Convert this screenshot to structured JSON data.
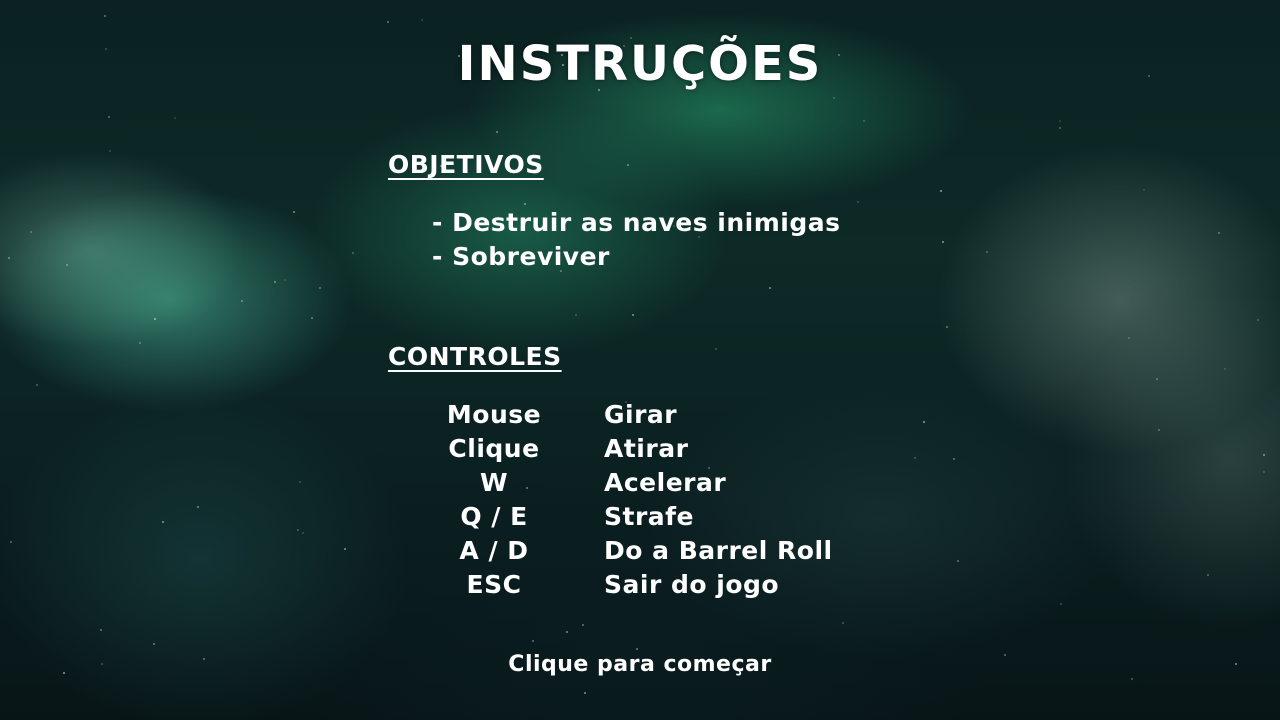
{
  "screen": {
    "title": "INSTRUÇÕES",
    "start_prompt": "Clique para começar"
  },
  "objectives": {
    "heading": "OBJETIVOS",
    "items": [
      "- Destruir as naves inimigas",
      "- Sobreviver"
    ]
  },
  "controls": {
    "heading": "CONTROLES",
    "rows": [
      {
        "key": "Mouse",
        "action": "Girar"
      },
      {
        "key": "Clique",
        "action": "Atirar"
      },
      {
        "key": "W",
        "action": "Acelerar"
      },
      {
        "key": "Q / E",
        "action": "Strafe"
      },
      {
        "key": "A / D",
        "action": "Do a Barrel Roll"
      },
      {
        "key": "ESC",
        "action": "Sair do jogo"
      }
    ]
  },
  "colors": {
    "text": "#ffffff",
    "background_dark": "#0b2122",
    "nebula_green": "#28a06e"
  }
}
